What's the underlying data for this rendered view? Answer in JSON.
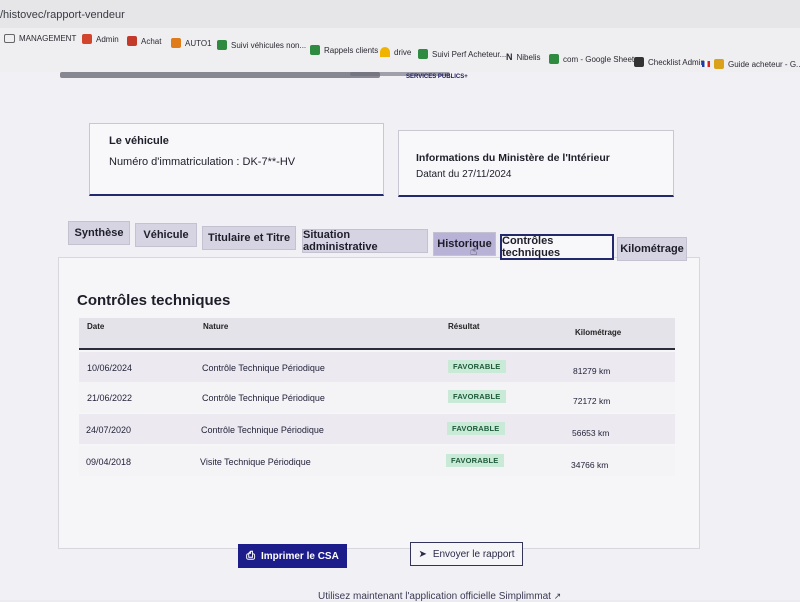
{
  "browser": {
    "url": "/histovec/rapport-vendeur",
    "bookmarks": [
      {
        "label": "MANAGEMENT",
        "icon": "folder-icon",
        "color": "#7a7a82"
      },
      {
        "label": "Admin",
        "icon": "admin-icon",
        "color": "#d2452c"
      },
      {
        "label": "Achat",
        "icon": "achat-icon",
        "color": "#c43a2a"
      },
      {
        "label": "AUTO1",
        "icon": "auto1-icon",
        "color": "#e07b1a"
      },
      {
        "label": "Suivi véhicules non...",
        "icon": "sheet-icon",
        "color": "#2e8b3f"
      },
      {
        "label": "Rappels clients",
        "icon": "sheet-icon",
        "color": "#2e8b3f"
      },
      {
        "label": "drive",
        "icon": "drive-icon",
        "color": "#f0b400"
      },
      {
        "label": "Suivi Perf Acheteur...",
        "icon": "sheet-icon",
        "color": "#2e8b3f"
      },
      {
        "label": "Nibelis",
        "icon": "nibelis-icon",
        "color": "#444"
      },
      {
        "label": "com - Google Sheets",
        "icon": "sheet-icon",
        "color": "#2e8b3f"
      },
      {
        "label": "Checklist Admin",
        "icon": "checklist-icon",
        "color": "#333"
      },
      {
        "label": "Guide acheteur - G...",
        "icon": "guide-icon",
        "color": "#d9a21a"
      }
    ]
  },
  "header": {
    "logo_text": "SERVICES PUBLICS+"
  },
  "vehicle_card": {
    "title": "Le véhicule",
    "plate_label": "Numéro d'immatriculation : DK-7**-HV"
  },
  "ministry_card": {
    "title": "Informations du Ministère de l'Intérieur",
    "date_label": "Datant du 27/11/2024"
  },
  "tabs": [
    {
      "label": "Synthèse"
    },
    {
      "label": "Véhicule"
    },
    {
      "label": "Titulaire et Titre"
    },
    {
      "label": "Situation administrative"
    },
    {
      "label": "Historique"
    },
    {
      "label": "Contrôles techniques"
    },
    {
      "label": "Kilométrage"
    }
  ],
  "section": {
    "title": "Contrôles techniques",
    "columns": [
      "Date",
      "Nature",
      "Résultat",
      "Kilométrage"
    ],
    "rows": [
      {
        "date": "10/06/2024",
        "nature": "Contrôle Technique Périodique",
        "result": "FAVORABLE",
        "km": "81279 km"
      },
      {
        "date": "21/06/2022",
        "nature": "Contrôle Technique Périodique",
        "result": "FAVORABLE",
        "km": "72172 km"
      },
      {
        "date": "24/07/2020",
        "nature": "Contrôle Technique Périodique",
        "result": "FAVORABLE",
        "km": "56653 km"
      },
      {
        "date": "09/04/2018",
        "nature": "Visite Technique Périodique",
        "result": "FAVORABLE",
        "km": "34766 km"
      }
    ]
  },
  "actions": {
    "print_label": "Imprimer le CSA",
    "send_label": "Envoyer le rapport"
  },
  "footer": {
    "note": "Utilisez maintenant l'application officielle Simplimmat"
  },
  "colors": {
    "primary": "#1c1c8a",
    "badge_bg": "#c9ead7",
    "badge_text": "#1c5a3a",
    "tab_bg": "#d6d3e2"
  }
}
